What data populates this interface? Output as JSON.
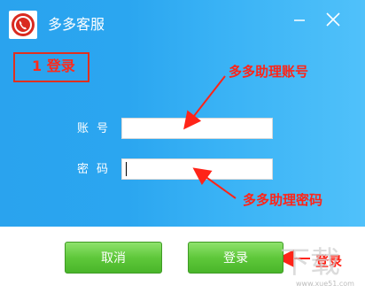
{
  "window": {
    "title": "多多客服",
    "app_icon": "phone-logo-icon",
    "minimize_icon": "minimize-icon",
    "close_icon": "close-icon"
  },
  "annotations": {
    "step_label": "1 登录",
    "account_note": "多多助理账号",
    "password_note": "多多助理密码",
    "login_note": "登录"
  },
  "form": {
    "account_label": "账号",
    "account_value": "",
    "password_label": "密码",
    "password_value": ""
  },
  "buttons": {
    "cancel_label": "取消",
    "login_label": "登录"
  },
  "colors": {
    "panel_blue": "#2ba6f0",
    "annotation_red": "#ff2418",
    "button_green": "#5fc83b"
  },
  "watermark": {
    "url": "www.xue51.com"
  }
}
